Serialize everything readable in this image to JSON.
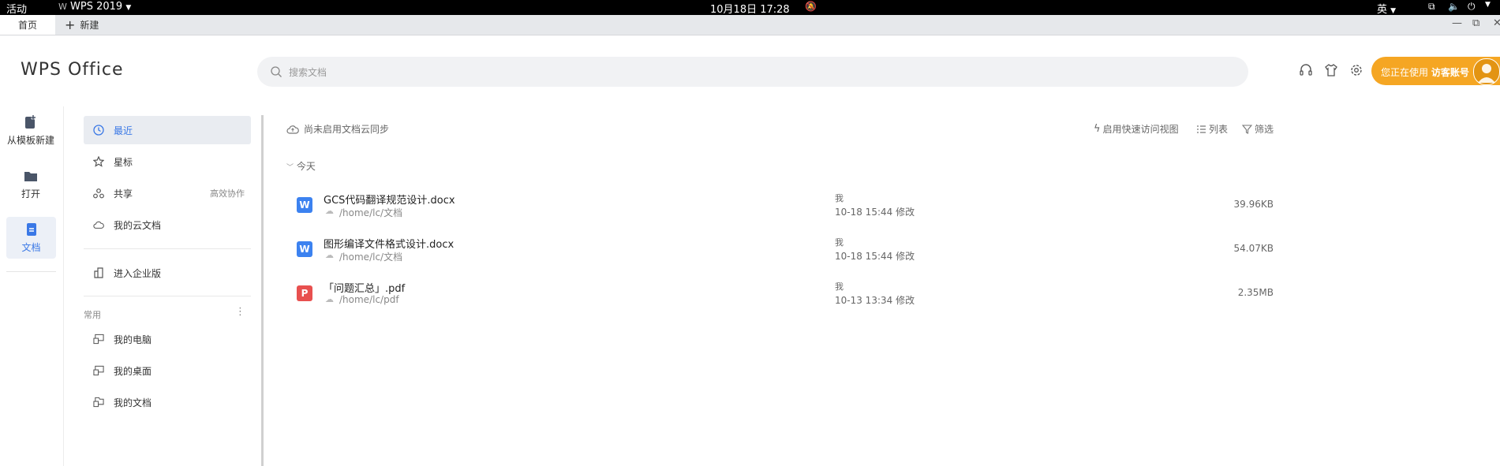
{
  "system_bar": {
    "activities": "活动",
    "app_name": "WPS 2019",
    "datetime": "10月18日  17:28",
    "input_method": "英"
  },
  "tabs": [
    {
      "label": "首页"
    },
    {
      "label": "新建"
    }
  ],
  "header": {
    "logo": "WPS Office",
    "search_placeholder": "搜索文档",
    "guest_prefix": "您正在使用",
    "guest_account": "访客账号"
  },
  "rail": [
    {
      "label": "从模板新建"
    },
    {
      "label": "打开"
    },
    {
      "label": "文档"
    }
  ],
  "nav": {
    "items": [
      {
        "label": "最近"
      },
      {
        "label": "星标"
      },
      {
        "label": "共享",
        "extra": "高效协作"
      },
      {
        "label": "我的云文档"
      },
      {
        "label": "进入企业版"
      }
    ],
    "common_label": "常用",
    "common_more": "⋮",
    "common": [
      {
        "label": "我的电脑"
      },
      {
        "label": "我的桌面"
      },
      {
        "label": "我的文档"
      }
    ]
  },
  "main": {
    "sync_text": "尚未启用文档云同步",
    "quick_view": "启用快速访问视图",
    "list_label": "列表",
    "filter_label": "筛选",
    "group_label": "今天",
    "files": [
      {
        "icon": "W",
        "name": "GCS代码翻译规范设计.docx",
        "path": "/home/lc/文档",
        "owner": "我",
        "time": "10-18 15:44 修改",
        "size": "39.96KB"
      },
      {
        "icon": "W",
        "name": "图形编译文件格式设计.docx",
        "path": "/home/lc/文档",
        "owner": "我",
        "time": "10-18 15:44 修改",
        "size": "54.07KB"
      },
      {
        "icon": "P",
        "name": "「问题汇总」.pdf",
        "path": "/home/lc/pdf",
        "owner": "我",
        "time": "10-13 13:34 修改",
        "size": "2.35MB"
      }
    ]
  },
  "colors": {
    "accent": "#3a78e6",
    "word_icon": "#3c82f0",
    "pdf_icon": "#e8504f",
    "guest_button": "#f5a623"
  }
}
